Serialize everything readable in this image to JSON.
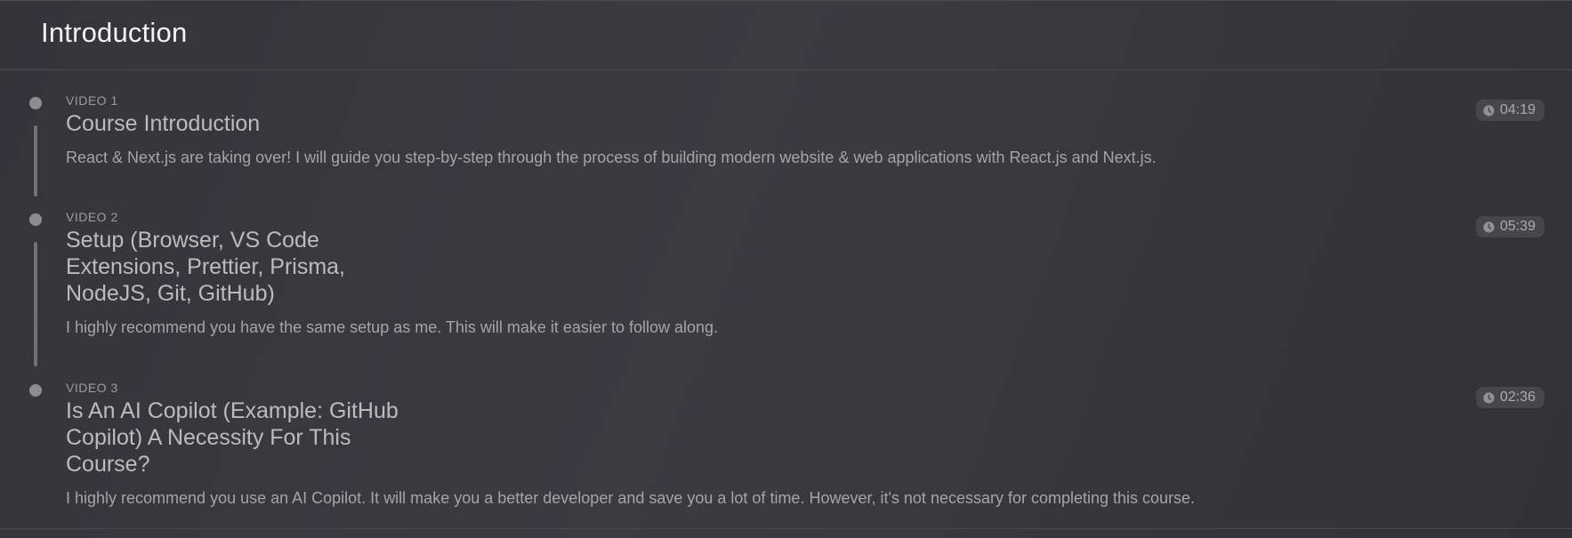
{
  "section": {
    "title": "Introduction"
  },
  "videos": [
    {
      "kicker": "VIDEO 1",
      "title": "Course Introduction",
      "description": "React & Next.js are taking over! I will guide you step-by-step through the process of building modern website & web applications with React.js and Next.js.",
      "duration": "04:19"
    },
    {
      "kicker": "VIDEO 2",
      "title": "Setup (Browser, VS Code Extensions, Prettier, Prisma, NodeJS, Git, GitHub)",
      "description": "I highly recommend you have the same setup as me. This will make it easier to follow along.",
      "duration": "05:39"
    },
    {
      "kicker": "VIDEO 3",
      "title": "Is An AI Copilot (Example: GitHub Copilot) A Necessity For This Course?",
      "description": "I highly recommend you use an AI Copilot. It will make you a better developer and save you a lot of time. However, it's not necessary for completing this course.",
      "duration": "02:36"
    }
  ],
  "icons": {
    "bullet": "timeline-dot-icon",
    "duration": "clock-icon"
  },
  "colors": {
    "background": "#2e3135",
    "title": "#f2f3f4",
    "text": "#b9bcc0",
    "muted": "#9a9da1",
    "badge": "#44484d"
  }
}
